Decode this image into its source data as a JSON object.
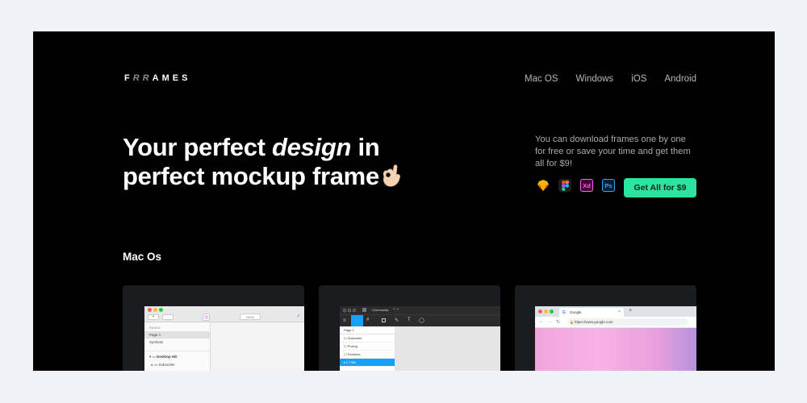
{
  "brand": {
    "prefix": "F",
    "middle": "RR",
    "suffix": "AMES"
  },
  "nav": [
    {
      "label": "Mac OS"
    },
    {
      "label": "Windows"
    },
    {
      "label": "iOS"
    },
    {
      "label": "Android"
    }
  ],
  "hero": {
    "line1_start": "Your perfect ",
    "line1_em": "design",
    "line1_end": " in",
    "line2": "perfect mockup frame"
  },
  "description": "You can download frames one by one for free or save your time and get them all for $9!",
  "tools": [
    {
      "name": "sketch-icon",
      "color": "#f7b500"
    },
    {
      "name": "figma-icon",
      "color": "#1e1e1e"
    },
    {
      "name": "xd-icon",
      "label": "Xd",
      "color": "#470137"
    },
    {
      "name": "photoshop-icon",
      "label": "Ps",
      "color": "#001e36"
    }
  ],
  "cta": {
    "label": "Get All for $9",
    "color": "#2de3a0"
  },
  "section": {
    "title": "Mac Os"
  },
  "cards": {
    "sketch": {
      "pages_header": "PAGES",
      "page1": "Page 1",
      "symbols": "Symbols",
      "artboard": "Desktop HD",
      "layer": "Subscribe",
      "zoom": "100%"
    },
    "figma": {
      "tab": "Community",
      "page": "Page 1",
      "items": [
        "Subscribe",
        "Pricing",
        "Features",
        "Title"
      ]
    },
    "chrome": {
      "tab": "Google",
      "url": "https://www.google.com"
    }
  }
}
